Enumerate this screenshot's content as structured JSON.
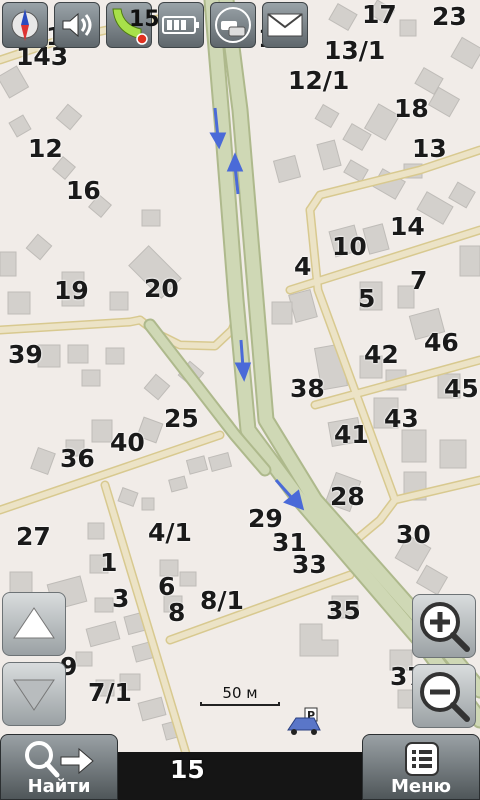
{
  "house_numbers": [
    {
      "id": "n17",
      "text": "17"
    },
    {
      "id": "n23",
      "text": "23"
    },
    {
      "id": "n143",
      "text": "143"
    },
    {
      "id": "n140",
      "text": "140"
    },
    {
      "id": "n13_1",
      "text": "13/1"
    },
    {
      "id": "n12_1",
      "text": "12/1"
    },
    {
      "id": "n11",
      "text": "11"
    },
    {
      "id": "n18",
      "text": "18"
    },
    {
      "id": "n12",
      "text": "12"
    },
    {
      "id": "n13",
      "text": "13"
    },
    {
      "id": "n16",
      "text": "16"
    },
    {
      "id": "n14",
      "text": "14"
    },
    {
      "id": "n10",
      "text": "10"
    },
    {
      "id": "n4",
      "text": "4"
    },
    {
      "id": "n7",
      "text": "7"
    },
    {
      "id": "n19",
      "text": "19"
    },
    {
      "id": "n20",
      "text": "20"
    },
    {
      "id": "n5",
      "text": "5"
    },
    {
      "id": "n39",
      "text": "39"
    },
    {
      "id": "n42",
      "text": "42"
    },
    {
      "id": "n46",
      "text": "46"
    },
    {
      "id": "n38",
      "text": "38"
    },
    {
      "id": "n45",
      "text": "45"
    },
    {
      "id": "n25",
      "text": "25"
    },
    {
      "id": "n43",
      "text": "43"
    },
    {
      "id": "n41",
      "text": "41"
    },
    {
      "id": "n40",
      "text": "40"
    },
    {
      "id": "n36",
      "text": "36"
    },
    {
      "id": "n28",
      "text": "28"
    },
    {
      "id": "n29",
      "text": "29"
    },
    {
      "id": "n4_1",
      "text": "4/1"
    },
    {
      "id": "n27",
      "text": "27"
    },
    {
      "id": "n31",
      "text": "31"
    },
    {
      "id": "n30",
      "text": "30"
    },
    {
      "id": "n1",
      "text": "1"
    },
    {
      "id": "n33",
      "text": "33"
    },
    {
      "id": "n6",
      "text": "6"
    },
    {
      "id": "n3",
      "text": "3"
    },
    {
      "id": "n8_1",
      "text": "8/1"
    },
    {
      "id": "n8",
      "text": "8"
    },
    {
      "id": "n35",
      "text": "35"
    },
    {
      "id": "n9",
      "text": "9"
    },
    {
      "id": "n7_1",
      "text": "7/1"
    },
    {
      "id": "n37",
      "text": "37"
    }
  ],
  "status_bar": {
    "satellite_count": "15",
    "icons": [
      "compass-icon",
      "volume-icon",
      "gps-signal-icon",
      "battery-icon",
      "traffic-icon",
      "message-icon"
    ]
  },
  "scale": {
    "label": "50 м"
  },
  "bottom": {
    "find_label": "Найти",
    "menu_label": "Меню",
    "street_number": "15"
  },
  "colors": {
    "map_background": "#f1ece8",
    "building": "#d3d0cc",
    "road": "#ece3c6",
    "road_edge": "#d8c98f",
    "highway": "#cfd8b5",
    "highway_edge": "#aeb98c",
    "oneway_arrow": "#4a6ad8"
  }
}
